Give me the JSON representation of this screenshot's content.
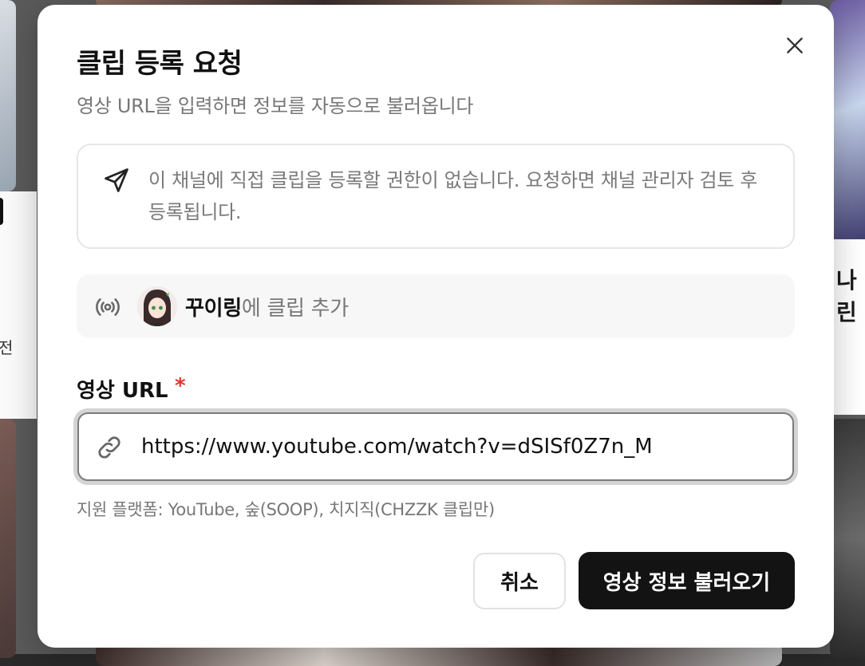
{
  "dialog": {
    "title": "클립 등록 요청",
    "subtitle": "영상 URL을 입력하면 정보를 자동으로 불러옵니다",
    "close_icon": "close-icon"
  },
  "notice": {
    "icon": "send-icon",
    "text": "이 채널에 직접 클립을 등록할 권한이 없습니다. 요청하면 채널 관리자 검토 후 등록됩니다."
  },
  "channel": {
    "icon": "live-broadcast-icon",
    "name": "꾸이링",
    "suffix": "에 클립 추가"
  },
  "url_field": {
    "label": "영상 URL",
    "required_mark": "*",
    "icon": "link-icon",
    "value": "https://www.youtube.com/watch?v=dSISf0Z7n_M",
    "hint": "지원 플랫폼: YouTube, 숲(SOOP), 치지직(CHZZK 클립만)"
  },
  "actions": {
    "cancel_label": "취소",
    "submit_label": "영상 정보 불러오기"
  },
  "background": {
    "partial_text_right": "나린",
    "partial_text_left": "전"
  },
  "colors": {
    "primary_button": "#131313",
    "required": "#e5342d",
    "muted_text": "#777777"
  }
}
